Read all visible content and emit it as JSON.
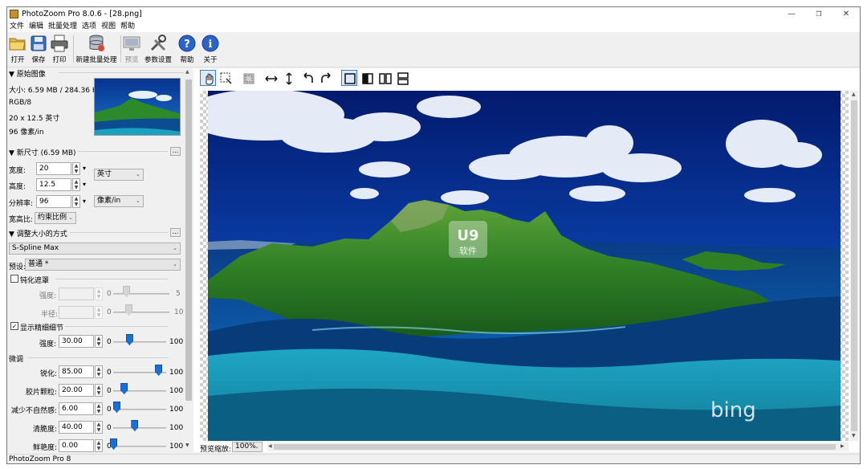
{
  "window": {
    "title": "PhotoZoom Pro 8.0.6 - [28.png]",
    "minimize": "—",
    "maximize": "❐",
    "close": "✕"
  },
  "menu": [
    "文件",
    "编辑",
    "批量处理",
    "选项",
    "视图",
    "帮助"
  ],
  "toolbar": {
    "open": "打开",
    "save": "保存",
    "print": "打印",
    "batch": "新建批量处理",
    "preview": "预览",
    "settings": "参数设置",
    "help": "帮助",
    "about": "关于"
  },
  "original": {
    "header": "▼ 原始图像",
    "size": "大小: 6.59 MB / 284.36 KB",
    "mode": "RGB/8",
    "dimensions": "20 x 12.5 英寸",
    "resolution": "96 像素/in"
  },
  "new_size": {
    "header": "▼ 新尺寸 (6.59 MB)",
    "width_label": "宽度:",
    "width_value": "20",
    "height_label": "高度:",
    "height_value": "12.5",
    "res_label": "分辨率:",
    "res_value": "96",
    "unit": "英寸",
    "res_unit": "像素/in",
    "ratio_label": "宽高比:",
    "ratio_value": "约束比例"
  },
  "method": {
    "header": "▼ 调整大小的方式",
    "algorithm": "S-Spline Max",
    "preset_label": "预设:",
    "preset_value": "普通 *",
    "unsharp": {
      "label": "钝化遮罩",
      "checked": false,
      "strength_label": "强度:",
      "strength_min": "0",
      "strength_max": "5",
      "radius_label": "半径:",
      "radius_min": "0",
      "radius_max": "10"
    },
    "detail": {
      "label": "显示精细细节",
      "checked": true,
      "strength_label": "强度:",
      "strength_value": "30.00",
      "min": "0",
      "max": "100",
      "level": 0.3
    }
  },
  "finetune": {
    "header": "微调",
    "rows": [
      {
        "label": "锐化:",
        "value": "85.00",
        "min": "0",
        "max": "100",
        "level": 0.85
      },
      {
        "label": "胶片颗粒:",
        "value": "20.00",
        "min": "0",
        "max": "100",
        "level": 0.2
      },
      {
        "label": "减少不自然感:",
        "value": "6.00",
        "min": "0",
        "max": "100",
        "level": 0.06
      },
      {
        "label": "清脆度:",
        "value": "40.00",
        "min": "0",
        "max": "100",
        "level": 0.4
      },
      {
        "label": "鲜艳度:",
        "value": "0.00",
        "min": "0",
        "max": "100",
        "level": 0.0
      }
    ]
  },
  "preview": {
    "zoom_label": "预览缩放:",
    "zoom_value": "100%"
  },
  "watermark": {
    "logo": "U9",
    "text": "软件",
    "brand": "bing"
  },
  "status": "PhotoZoom Pro 8",
  "colors": {
    "accent": "#1a6fd6",
    "active_tool": "#3c7fd1"
  }
}
